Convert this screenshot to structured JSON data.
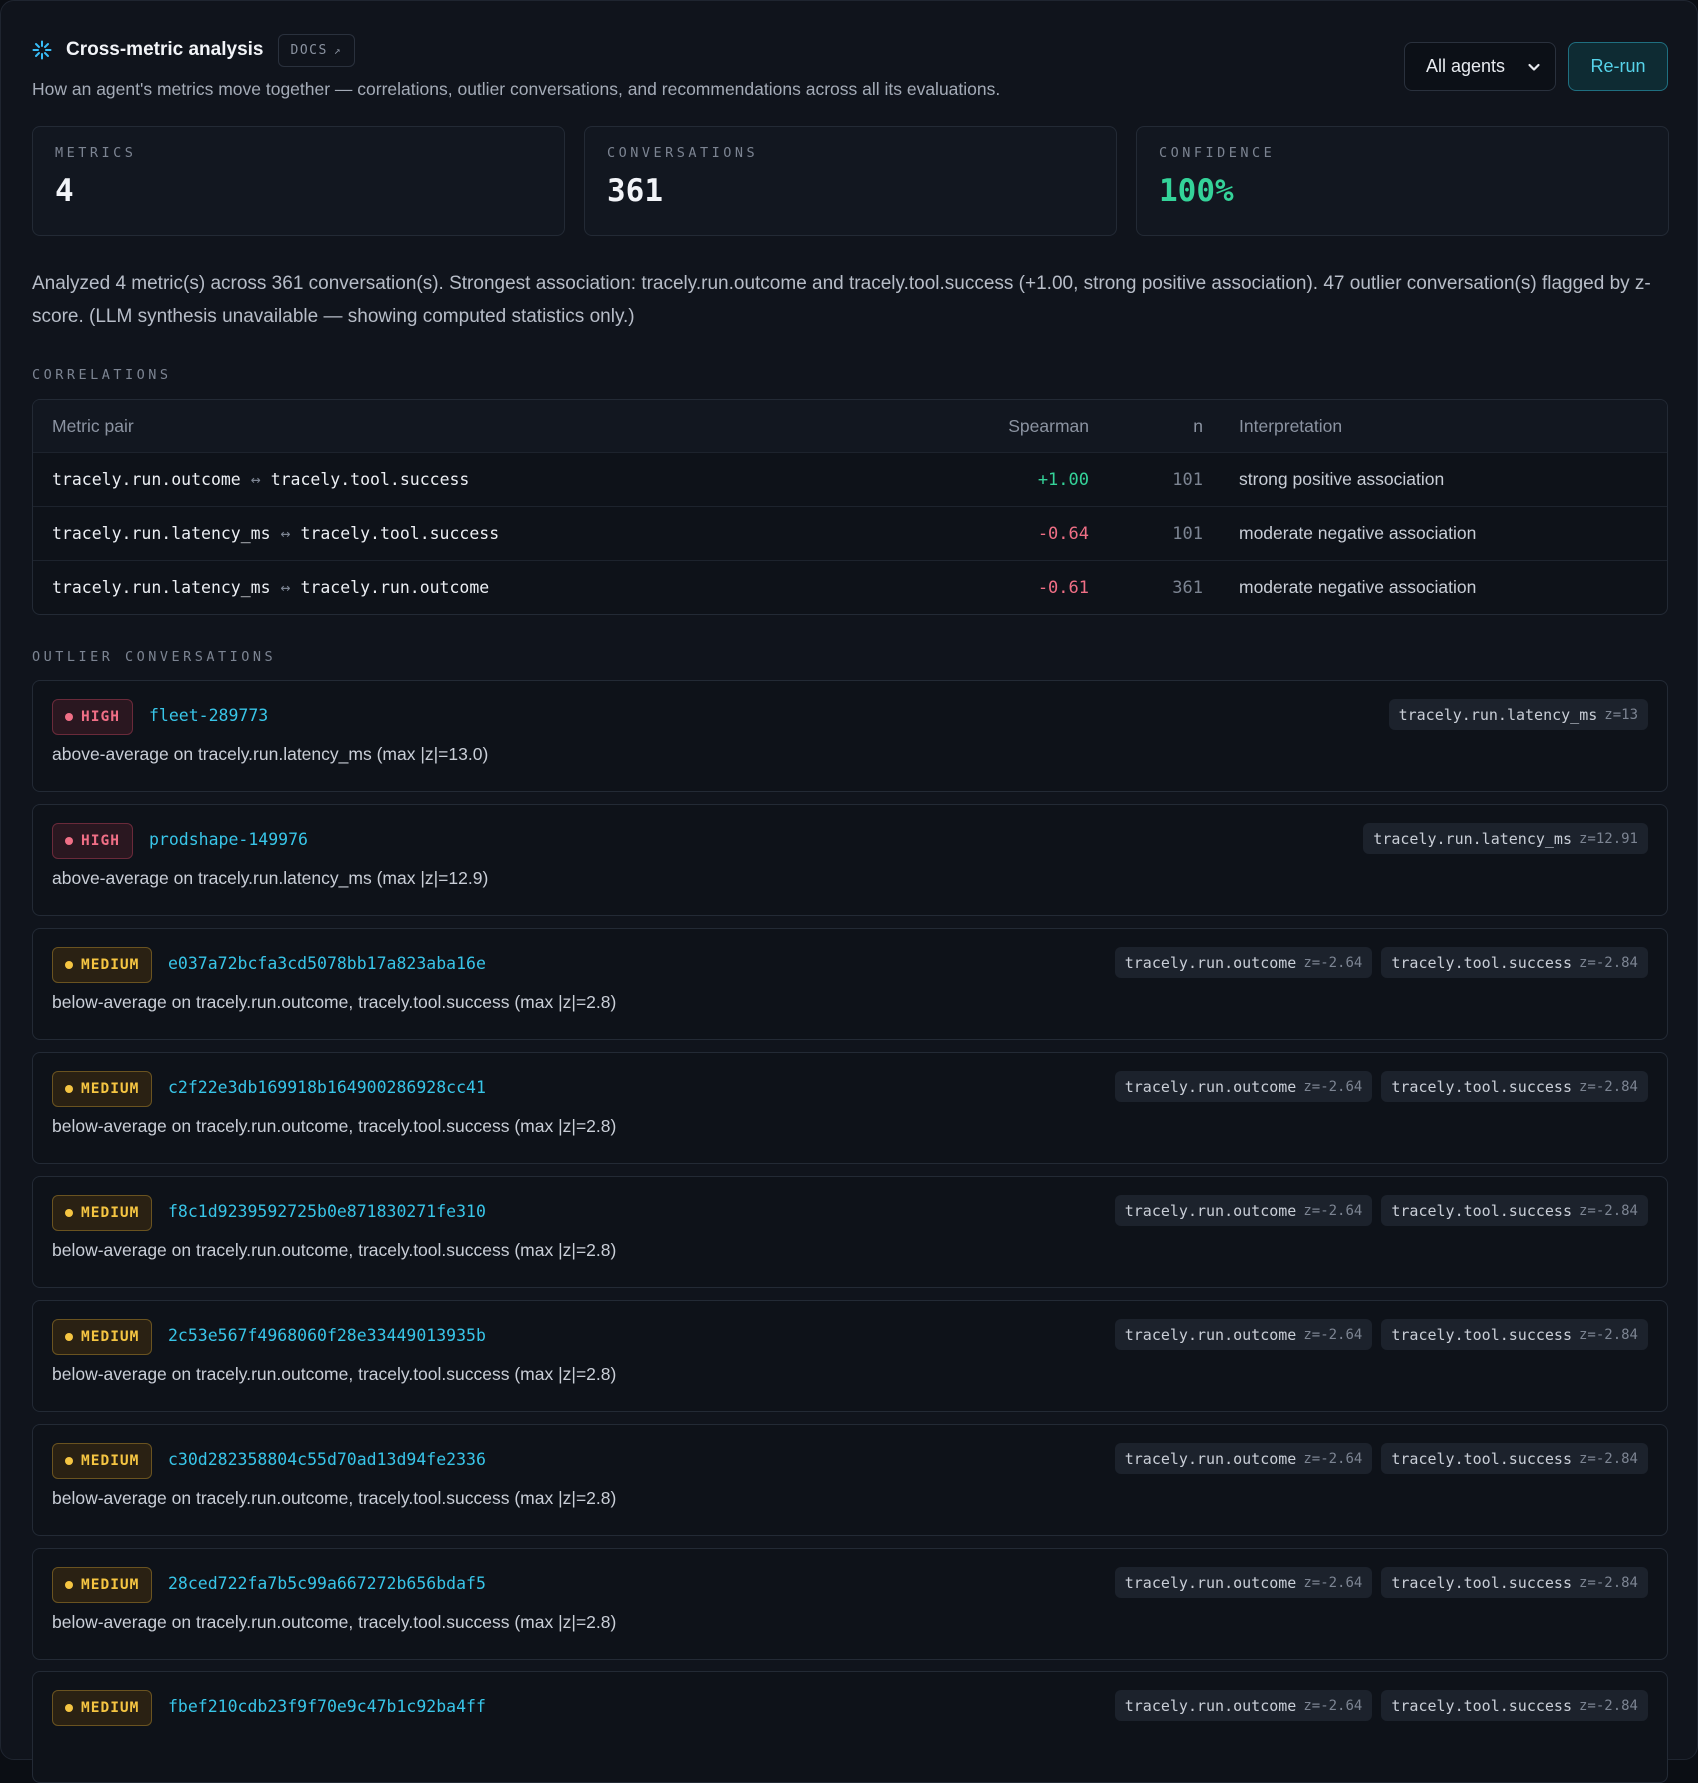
{
  "header": {
    "title": "Cross-metric analysis",
    "docs_label": "DOCS",
    "docs_arrow": "↗",
    "subtitle": "How an agent's metrics move together — correlations, outlier conversations, and recommendations across all its evaluations.",
    "agent_select": "All agents",
    "rerun_label": "Re-run"
  },
  "stats": [
    {
      "label": "METRICS",
      "value": "4"
    },
    {
      "label": "CONVERSATIONS",
      "value": "361"
    },
    {
      "label": "CONFIDENCE",
      "value": "100%"
    }
  ],
  "summary": "Analyzed 4 metric(s) across 361 conversation(s). Strongest association: tracely.run.outcome and tracely.tool.success (+1.00, strong positive association). 47 outlier conversation(s) flagged by z-score. (LLM synthesis unavailable — showing computed statistics only.)",
  "correlations": {
    "section_label": "CORRELATIONS",
    "headers": {
      "pair": "Metric pair",
      "spearman": "Spearman",
      "n": "n",
      "interpretation": "Interpretation"
    },
    "separator": "↔",
    "rows": [
      {
        "a": "tracely.run.outcome",
        "b": "tracely.tool.success",
        "spearman": "+1.00",
        "n": "101",
        "interpretation": "strong positive association"
      },
      {
        "a": "tracely.run.latency_ms",
        "b": "tracely.tool.success",
        "spearman": "-0.64",
        "n": "101",
        "interpretation": "moderate negative association"
      },
      {
        "a": "tracely.run.latency_ms",
        "b": "tracely.run.outcome",
        "spearman": "-0.61",
        "n": "361",
        "interpretation": "moderate negative association"
      }
    ]
  },
  "outliers": {
    "section_label": "OUTLIER CONVERSATIONS",
    "items": [
      {
        "severity": "HIGH",
        "id": "fleet-289773",
        "description": "above-average on tracely.run.latency_ms (max |z|=13.0)",
        "chips": [
          {
            "metric": "tracely.run.latency_ms",
            "z": "z=13"
          }
        ]
      },
      {
        "severity": "HIGH",
        "id": "prodshape-149976",
        "description": "above-average on tracely.run.latency_ms (max |z|=12.9)",
        "chips": [
          {
            "metric": "tracely.run.latency_ms",
            "z": "z=12.91"
          }
        ]
      },
      {
        "severity": "MEDIUM",
        "id": "e037a72bcfa3cd5078bb17a823aba16e",
        "description": "below-average on tracely.run.outcome, tracely.tool.success (max |z|=2.8)",
        "chips": [
          {
            "metric": "tracely.run.outcome",
            "z": "z=-2.64"
          },
          {
            "metric": "tracely.tool.success",
            "z": "z=-2.84"
          }
        ]
      },
      {
        "severity": "MEDIUM",
        "id": "c2f22e3db169918b164900286928cc41",
        "description": "below-average on tracely.run.outcome, tracely.tool.success (max |z|=2.8)",
        "chips": [
          {
            "metric": "tracely.run.outcome",
            "z": "z=-2.64"
          },
          {
            "metric": "tracely.tool.success",
            "z": "z=-2.84"
          }
        ]
      },
      {
        "severity": "MEDIUM",
        "id": "f8c1d9239592725b0e871830271fe310",
        "description": "below-average on tracely.run.outcome, tracely.tool.success (max |z|=2.8)",
        "chips": [
          {
            "metric": "tracely.run.outcome",
            "z": "z=-2.64"
          },
          {
            "metric": "tracely.tool.success",
            "z": "z=-2.84"
          }
        ]
      },
      {
        "severity": "MEDIUM",
        "id": "2c53e567f4968060f28e33449013935b",
        "description": "below-average on tracely.run.outcome, tracely.tool.success (max |z|=2.8)",
        "chips": [
          {
            "metric": "tracely.run.outcome",
            "z": "z=-2.64"
          },
          {
            "metric": "tracely.tool.success",
            "z": "z=-2.84"
          }
        ]
      },
      {
        "severity": "MEDIUM",
        "id": "c30d282358804c55d70ad13d94fe2336",
        "description": "below-average on tracely.run.outcome, tracely.tool.success (max |z|=2.8)",
        "chips": [
          {
            "metric": "tracely.run.outcome",
            "z": "z=-2.64"
          },
          {
            "metric": "tracely.tool.success",
            "z": "z=-2.84"
          }
        ]
      },
      {
        "severity": "MEDIUM",
        "id": "28ced722fa7b5c99a667272b656bdaf5",
        "description": "below-average on tracely.run.outcome, tracely.tool.success (max |z|=2.8)",
        "chips": [
          {
            "metric": "tracely.run.outcome",
            "z": "z=-2.64"
          },
          {
            "metric": "tracely.tool.success",
            "z": "z=-2.84"
          }
        ]
      },
      {
        "severity": "MEDIUM",
        "id": "fbef210cdb23f9f70e9c47b1c92ba4ff",
        "description": "",
        "chips": [
          {
            "metric": "tracely.run.outcome",
            "z": "z=-2.64"
          },
          {
            "metric": "tracely.tool.success",
            "z": "z=-2.84"
          }
        ]
      }
    ]
  }
}
